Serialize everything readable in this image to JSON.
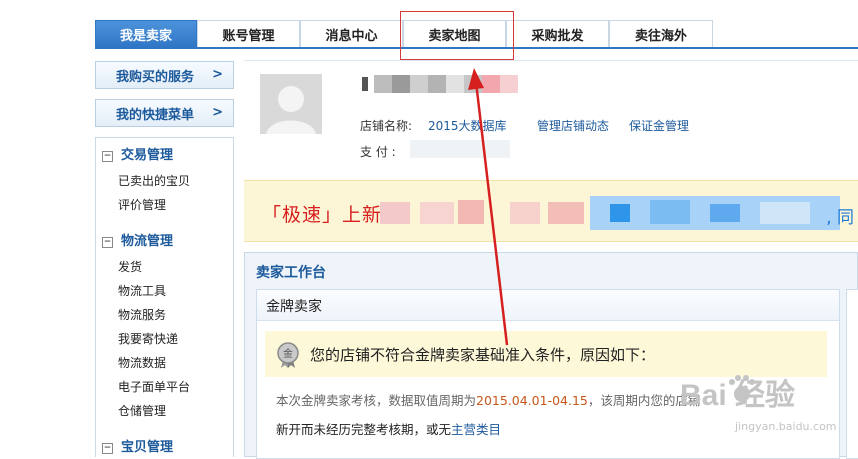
{
  "tabs": [
    {
      "label": "我是卖家",
      "active": true
    },
    {
      "label": "账号管理"
    },
    {
      "label": "消息中心"
    },
    {
      "label": "卖家地图"
    },
    {
      "label": "采购批发"
    },
    {
      "label": "卖往海外"
    }
  ],
  "sidebar": {
    "buttons": [
      {
        "label": "我购买的服务",
        "chevron": ">"
      },
      {
        "label": "我的快捷菜单",
        "chevron": ">"
      }
    ],
    "sections": [
      {
        "title": "交易管理",
        "toggle": "⊟",
        "items": [
          "已卖出的宝贝",
          "评价管理"
        ]
      },
      {
        "title": "物流管理",
        "toggle": "⊟",
        "items": [
          "发货",
          "物流工具",
          "物流服务",
          "我要寄快递",
          "物流数据",
          "电子面单平台",
          "仓储管理"
        ]
      },
      {
        "title": "宝贝管理",
        "toggle": "⊟",
        "items": []
      }
    ]
  },
  "profile": {
    "store_label": "店铺名称:",
    "store_name": "2015大数据库",
    "link_store_dynamics": "管理店铺动态",
    "link_deposit": "保证金管理",
    "pay_label": "支 付 :"
  },
  "announcement": {
    "text": "「极速」上新",
    "right_fragment": ", 同"
  },
  "workbench": {
    "title": "卖家工作台",
    "gold_panel_title": "金牌卖家",
    "medal_char": "金",
    "warning": "您的店铺不符合金牌卖家基础准入条件，原因如下：",
    "note1_prefix": "本次金牌卖家考核，数据取值周期为",
    "note1_date": "2015.04.01-04.15",
    "note1_suffix": "，该周期内您的店铺",
    "note2_prefix": "新开而未经历完整考核期，或无",
    "note2_link": "主营类目"
  },
  "watermark": {
    "text": "Bai 经验",
    "url": "jingyan.baidu.com"
  },
  "colors": {
    "accent": "#2f76c6",
    "link": "#1d5a9c",
    "announce_red": "#d62020",
    "date_orange": "#c8571a",
    "highlight_red": "#d43a3a"
  }
}
